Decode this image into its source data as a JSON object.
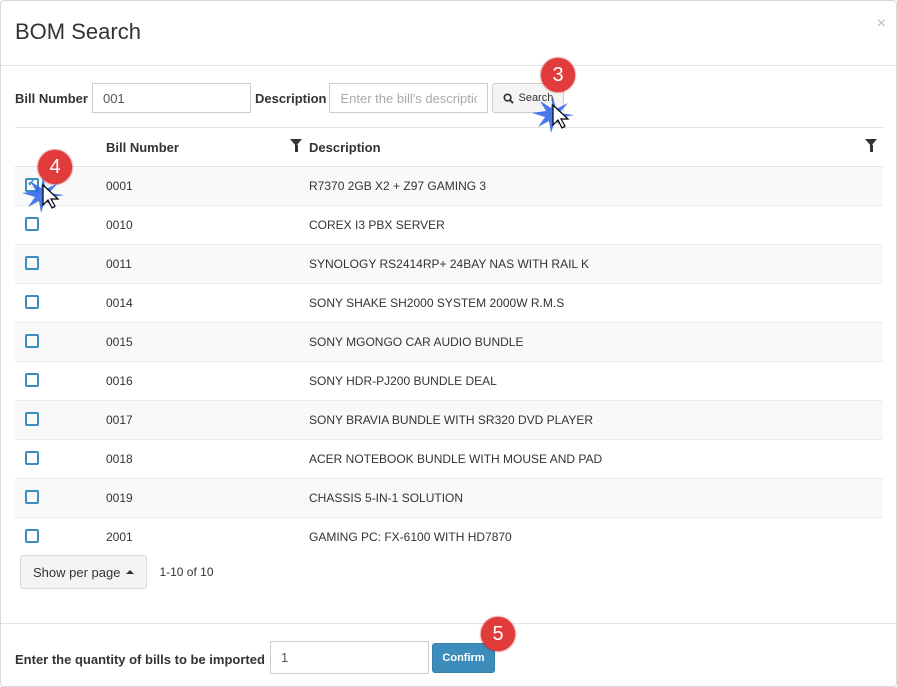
{
  "dialog": {
    "title": "BOM Search",
    "close_label": "×"
  },
  "filters": {
    "bill_number_label": "Bill Number",
    "bill_number_value": "001",
    "description_label": "Description",
    "description_placeholder": "Enter the bill's description",
    "search_label": "Search"
  },
  "table": {
    "columns": [
      "Bill Number",
      "Description"
    ],
    "rows": [
      {
        "bill": "0001",
        "desc": "R7370 2GB X2 + Z97 GAMING 3",
        "checked": true
      },
      {
        "bill": "0010",
        "desc": "COREX I3 PBX SERVER",
        "checked": false
      },
      {
        "bill": "0011",
        "desc": "SYNOLOGY RS2414RP+ 24BAY NAS WITH RAIL K",
        "checked": false
      },
      {
        "bill": "0014",
        "desc": "SONY SHAKE SH2000 SYSTEM 2000W R.M.S",
        "checked": false
      },
      {
        "bill": "0015",
        "desc": "SONY MGONGO CAR AUDIO BUNDLE",
        "checked": false
      },
      {
        "bill": "0016",
        "desc": "SONY HDR-PJ200 BUNDLE DEAL",
        "checked": false
      },
      {
        "bill": "0017",
        "desc": "SONY BRAVIA BUNDLE WITH SR320 DVD PLAYER",
        "checked": false
      },
      {
        "bill": "0018",
        "desc": "ACER NOTEBOOK BUNDLE WITH MOUSE AND PAD",
        "checked": false
      },
      {
        "bill": "0019",
        "desc": "CHASSIS 5-IN-1 SOLUTION",
        "checked": false
      },
      {
        "bill": "2001",
        "desc": "GAMING PC: FX-6100 WITH HD7870",
        "checked": false
      }
    ]
  },
  "pagination": {
    "per_page_label": "Show per page",
    "range": "1-10 of 10"
  },
  "footer": {
    "quantity_label": "Enter the quantity of bills to be imported",
    "quantity_value": "1",
    "confirm_label": "Confirm"
  },
  "annotations": {
    "step3": "3",
    "step4": "4",
    "step5": "5"
  },
  "colors": {
    "primary": "#3c8dbc",
    "badge": "#e23b3b"
  }
}
